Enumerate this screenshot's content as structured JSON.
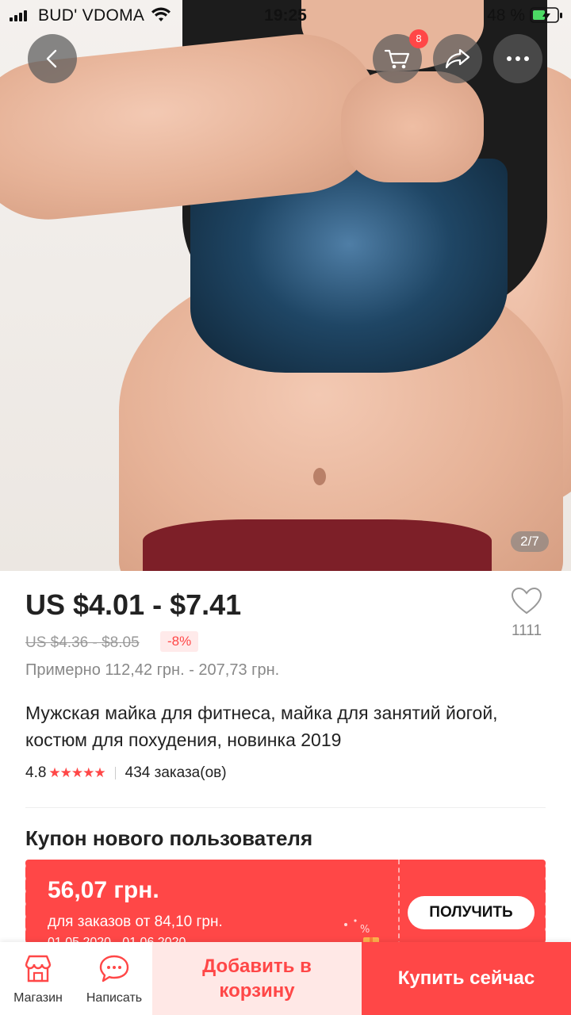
{
  "status": {
    "carrier": "BUD' VDOMA",
    "time": "19:25",
    "battery": "48 %"
  },
  "header": {
    "cart_count": "8"
  },
  "gallery": {
    "indicator": "2/7"
  },
  "product": {
    "price": "US $4.01 - $7.41",
    "old_price": "US $4.36 - $8.05",
    "discount": "-8%",
    "approx": "Примерно 112,42 грн. - 207,73 грн.",
    "wishlist_count": "1111",
    "title": "Мужская майка для фитнеса, майка для занятий йогой, костюм для похудения, новинка 2019",
    "rating": "4.8",
    "stars": "★★★★★",
    "orders": "434 заказа(ов)"
  },
  "coupon": {
    "section_title": "Купон нового пользователя",
    "amount": "56,07 грн.",
    "condition": "для заказов от 84,10 грн.",
    "dates": "01.05.2020 - 01.06.2020",
    "button": "ПОЛУЧИТЬ"
  },
  "bottom_bar": {
    "store_label": "Магазин",
    "message_label": "Написать",
    "add_to_cart": "Добавить в корзину",
    "buy_now": "Купить сейчас"
  },
  "colors": {
    "accent": "#ff4747",
    "accent_light": "#ffe8e6"
  }
}
